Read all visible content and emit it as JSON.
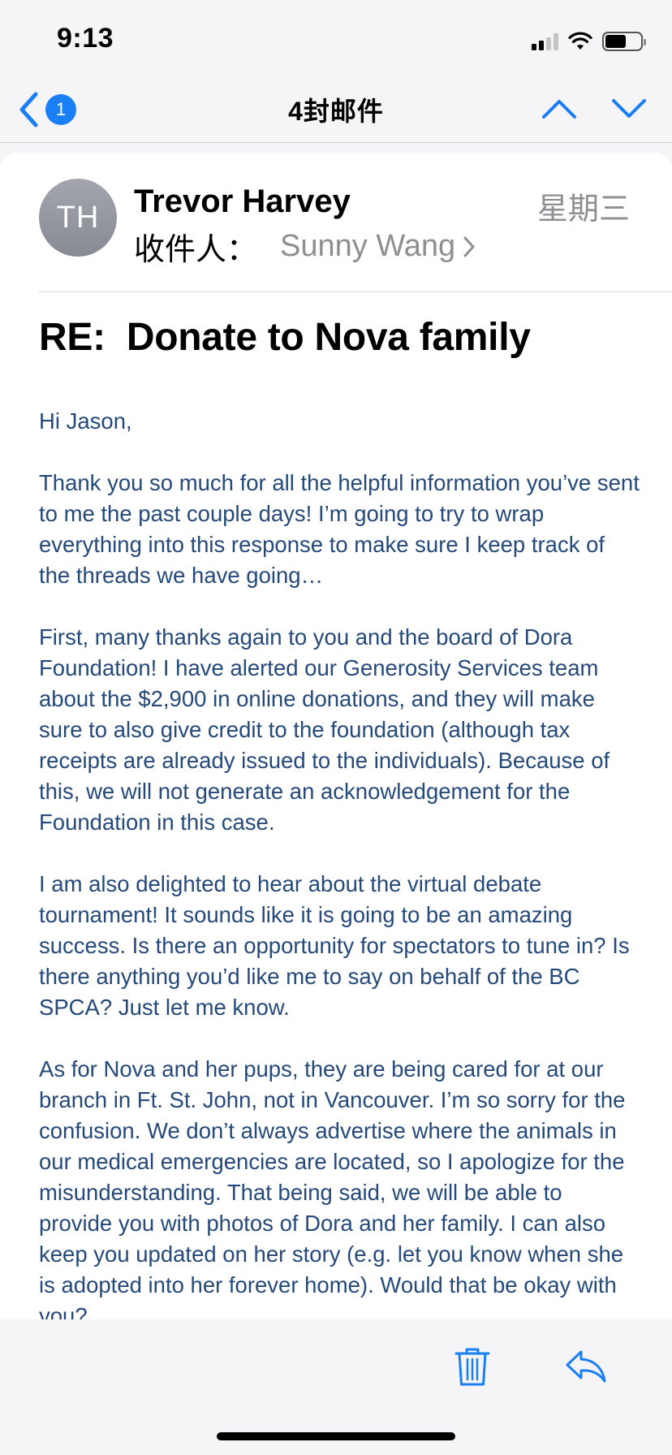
{
  "status_bar": {
    "time": "9:13"
  },
  "nav": {
    "back_badge": "1",
    "title": "4封邮件"
  },
  "email": {
    "avatar_initials": "TH",
    "sender": "Trevor Harvey",
    "date": "星期三",
    "recipient_label": "收件人：",
    "recipient": "Sunny Wang",
    "subject": "RE:  Donate to Nova family",
    "body": [
      "Hi Jason,",
      "Thank you so much for all the helpful information you’ve sent to me the past couple days! I’m going to try to wrap everything into this response to make sure I keep track of the threads we have going…",
      "First, many thanks again to you and the board of Dora Foundation! I have alerted our Generosity Services team about the $2,900 in online donations, and they will make sure to also give credit to the foundation (although tax receipts are already issued to the individuals). Because of this, we will not generate an acknowledgement for the Foundation in this case.",
      "I am also delighted to hear about the virtual debate tournament! It sounds like it is going to be an amazing success. Is there an opportunity for spectators to tune in? Is there anything you’d like me to say on behalf of the BC SPCA? Just let me know.",
      "As for Nova and her pups, they are being cared for at our branch in Ft. St. John, not in Vancouver. I’m so sorry for the confusion. We don’t always advertise where the animals in our medical emergencies are located, so I apologize for the misunderstanding. That being said, we will be able to provide you with photos of Dora and her family. I can also keep you updated on her story (e.g. let you know when she is adopted into her forever home). Would that be okay with you?"
    ]
  },
  "colors": {
    "accent": "#1a7ef5",
    "body_text": "#25497a",
    "secondary_text": "#8e8e93"
  },
  "icons": {
    "back": "chevron-left-icon",
    "prev": "chevron-up-icon",
    "next": "chevron-down-icon",
    "trash": "trash-icon",
    "reply": "reply-icon"
  }
}
